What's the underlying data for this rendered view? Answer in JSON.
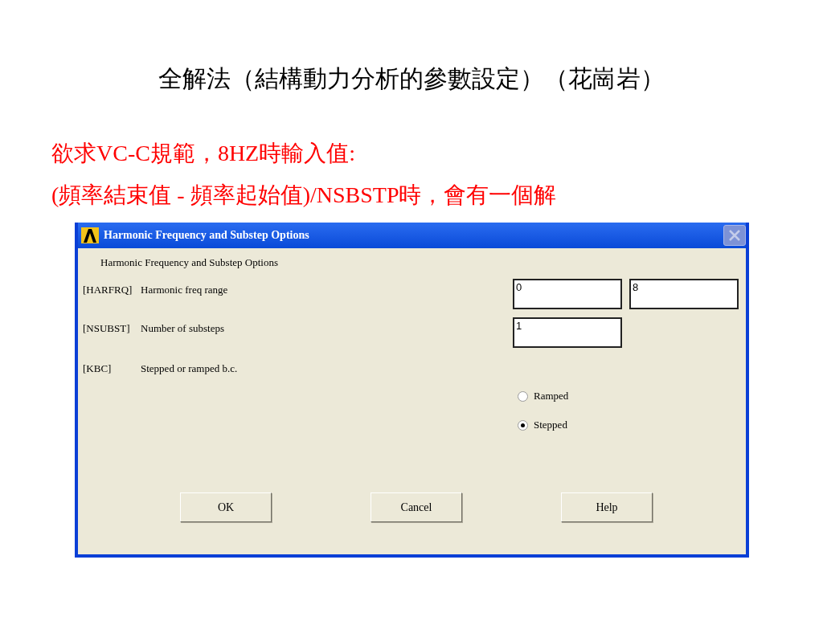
{
  "slide": {
    "title": "全解法（結構動力分析的參數設定）（花崗岩）",
    "notes": [
      "欲求VC-C規範，8HZ時輸入值:",
      "(頻率結束值 - 頻率起始值)/NSBSTP時，會有一個解"
    ]
  },
  "dialog": {
    "title": "Harmonic Frequency and Substep Options",
    "heading": "Harmonic Frequency and Substep Options",
    "rows": [
      {
        "kind": "fields",
        "code": "[HARFRQ]",
        "description": "Harmonic freq range",
        "values": [
          "0",
          "8"
        ]
      },
      {
        "kind": "fields",
        "code": "[NSUBST]",
        "description": "Number of substeps",
        "values": [
          "1"
        ]
      },
      {
        "kind": "radios",
        "code": "[KBC]",
        "description": "Stepped or ramped b.c.",
        "options": [
          {
            "label": "Ramped",
            "selected": false
          },
          {
            "label": "Stepped",
            "selected": true
          }
        ]
      }
    ],
    "buttons": [
      "OK",
      "Cancel",
      "Help"
    ]
  }
}
